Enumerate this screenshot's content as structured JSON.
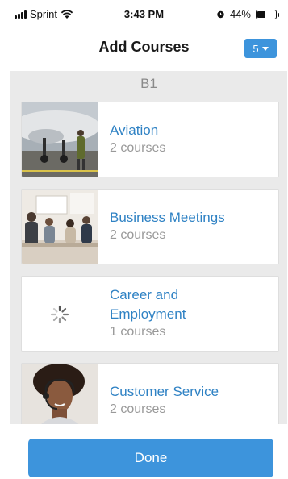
{
  "status": {
    "carrier": "Sprint",
    "time": "3:43 PM",
    "battery_pct": "44%",
    "battery_level": 0.44
  },
  "header": {
    "title": "Add Courses",
    "level_button": "5"
  },
  "section": {
    "label": "B1"
  },
  "courses": [
    {
      "title": "Aviation",
      "count": "2 courses",
      "thumbnail": "airport-scene"
    },
    {
      "title": "Business Meetings",
      "count": "2 courses",
      "thumbnail": "meeting-scene"
    },
    {
      "title_line1": "Career and",
      "title_line2": "Employment",
      "count": "1 courses",
      "thumbnail": "loading-spinner"
    },
    {
      "title": "Customer Service",
      "count": "2 courses",
      "thumbnail": "headset-agent"
    }
  ],
  "footer": {
    "done_label": "Done"
  },
  "colors": {
    "accent": "#3d94dc",
    "link": "#2f82c4",
    "background": "#eaeaea"
  }
}
